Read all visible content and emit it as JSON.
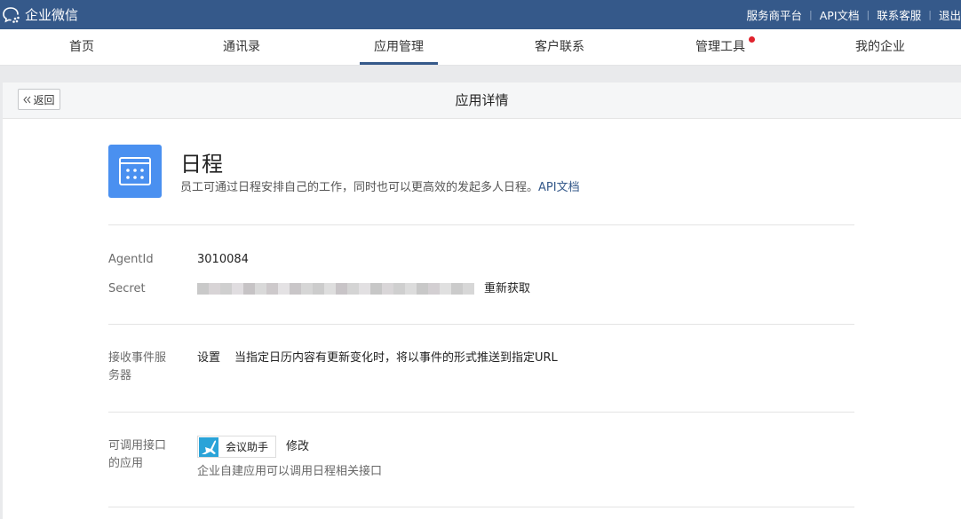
{
  "topbar": {
    "brand": "企业微信",
    "links": [
      "服务商平台",
      "API文档",
      "联系客服",
      "退出"
    ]
  },
  "nav": {
    "items": [
      "首页",
      "通讯录",
      "应用管理",
      "客户联系",
      "管理工具",
      "我的企业"
    ],
    "active": "应用管理"
  },
  "panel": {
    "back_label": "返回",
    "title": "应用详情"
  },
  "app": {
    "name": "日程",
    "description": "员工可通过日程安排自己的工作，同时也可以更高效的发起多人日程。",
    "doc_link": "API文档",
    "icon": "calendar-icon"
  },
  "details": {
    "agentid_label": "AgentId",
    "agentid_value": "3010084",
    "secret_label": "Secret",
    "secret_action": "重新获取"
  },
  "event_server": {
    "label": "接收事件服务器",
    "action": "设置",
    "description": "当指定日历内容有更新变化时，将以事件的形式推送到指定URL"
  },
  "callable": {
    "label": "可调用接口的应用",
    "app_name": "会议助手",
    "edit": "修改",
    "note": "企业自建应用可以调用日程相关接口"
  },
  "colors": {
    "topbar": "#35598a",
    "accent": "#35598a",
    "app_icon": "#4a90f0",
    "nav_dot": "#e0232d"
  }
}
